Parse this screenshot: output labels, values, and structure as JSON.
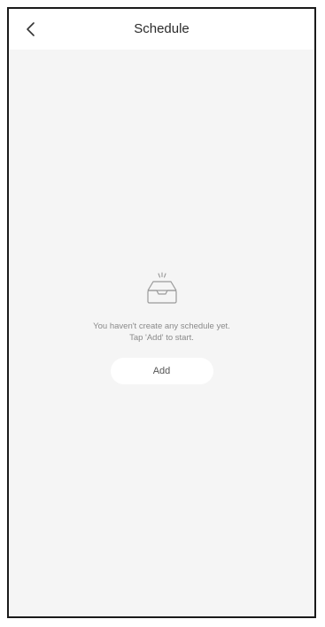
{
  "header": {
    "title": "Schedule",
    "back_icon": "chevron-left-icon"
  },
  "empty_state": {
    "icon": "empty-tray-icon",
    "message_line1": "You haven't create any schedule yet.",
    "message_line2": "Tap 'Add' to start.",
    "add_label": "Add"
  },
  "colors": {
    "background": "#f5f5f5",
    "header_bg": "#ffffff",
    "text_muted": "#8a8a8a",
    "button_bg": "#ffffff"
  }
}
